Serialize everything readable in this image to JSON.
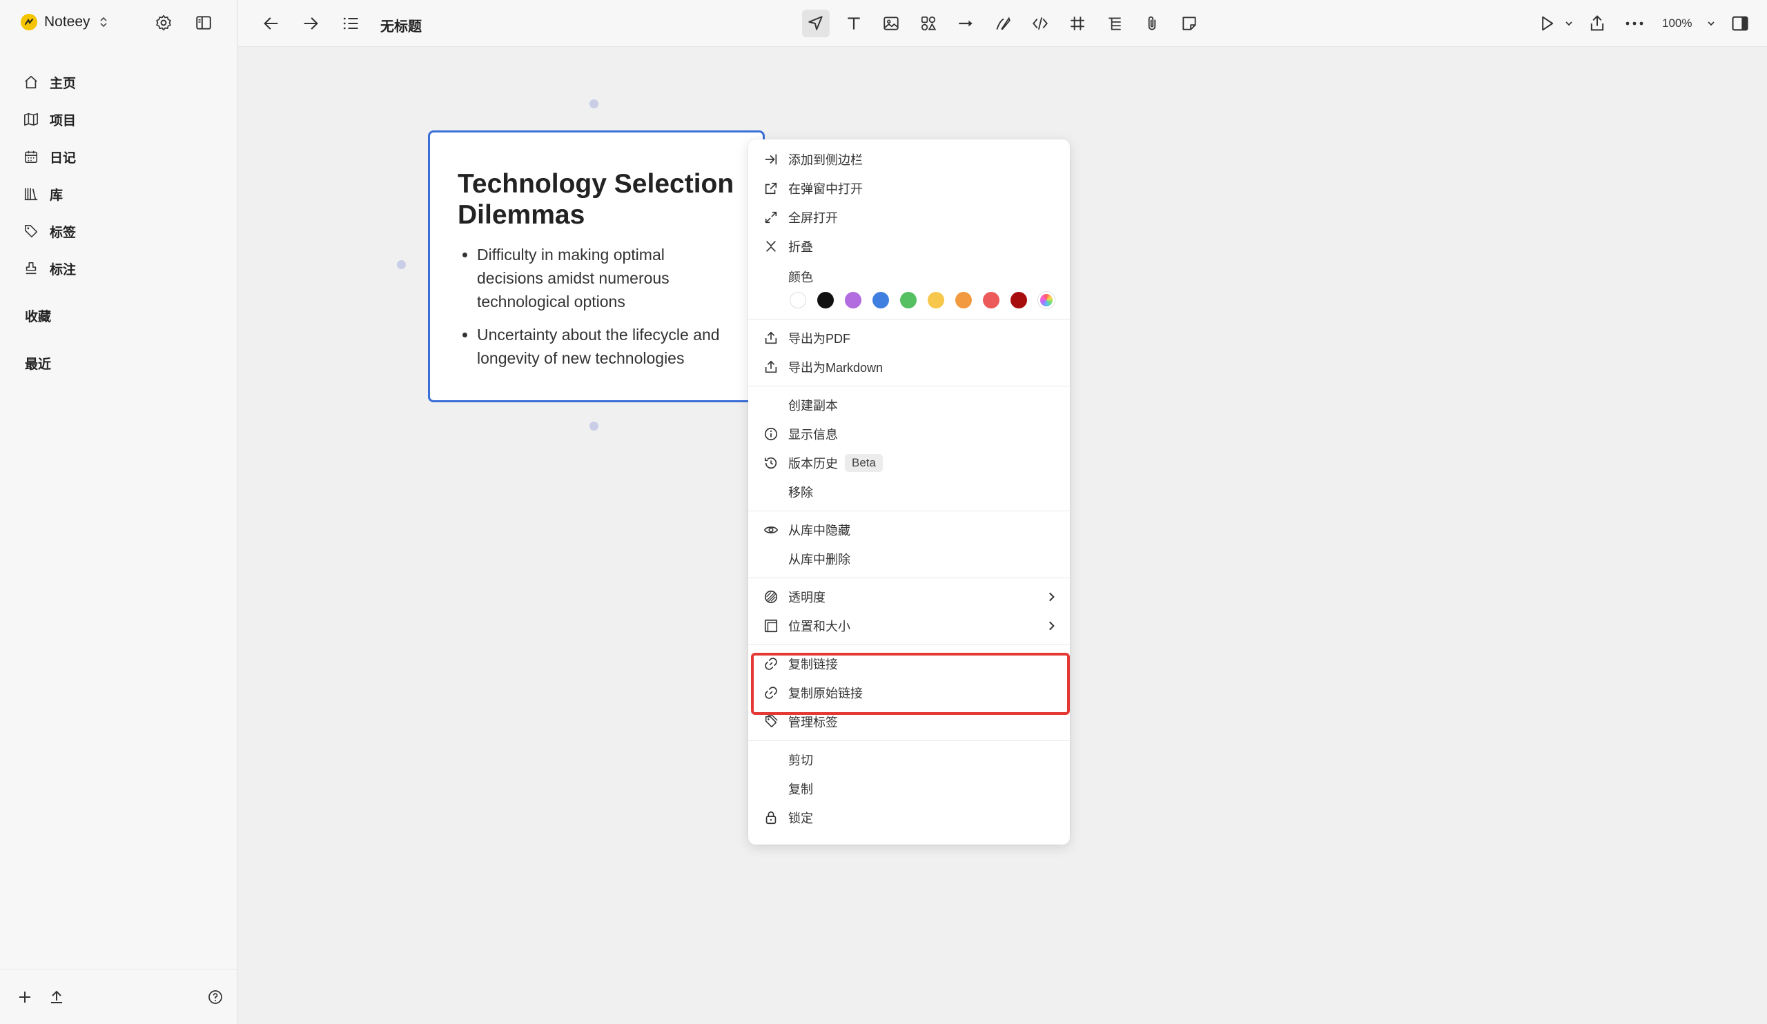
{
  "sidebar": {
    "brand": "Noteey",
    "items": [
      {
        "icon": "home-icon",
        "label": "主页"
      },
      {
        "icon": "book-icon",
        "label": "项目"
      },
      {
        "icon": "calendar-icon",
        "label": "日记"
      },
      {
        "icon": "library-icon",
        "label": "库"
      },
      {
        "icon": "tag-icon",
        "label": "标签"
      },
      {
        "icon": "stamp-icon",
        "label": "标注"
      }
    ],
    "favorites": "收藏",
    "recent": "最近"
  },
  "topbar": {
    "title": "无标题",
    "zoom": "100%"
  },
  "card": {
    "title": "Technology Selection Dilemmas",
    "bullets": [
      "Difficulty in making optimal decisions amidst numerous technological options",
      "Uncertainty about the lifecycle and longevity of new technologies"
    ]
  },
  "menu": {
    "add_sidebar": "添加到侧边栏",
    "open_popup": "在弹窗中打开",
    "fullscreen": "全屏打开",
    "collapse": "折叠",
    "color_label": "颜色",
    "colors": [
      "#ffffff",
      "#111111",
      "#b36be0",
      "#3f7fe0",
      "#55c062",
      "#f6c74a",
      "#f29a3f",
      "#ec5a5a",
      "#a80d0d"
    ],
    "export_pdf": "导出为PDF",
    "export_md": "导出为Markdown",
    "duplicate": "创建副本",
    "show_info": "显示信息",
    "history": "版本历史",
    "beta": "Beta",
    "move": "移除",
    "hide_library": "从库中隐藏",
    "delete_library": "从库中删除",
    "opacity": "透明度",
    "position_size": "位置和大小",
    "copy_link": "复制链接",
    "copy_raw_link": "复制原始链接",
    "manage_tags": "管理标签",
    "cut": "剪切",
    "copy": "复制",
    "lock": "锁定"
  }
}
